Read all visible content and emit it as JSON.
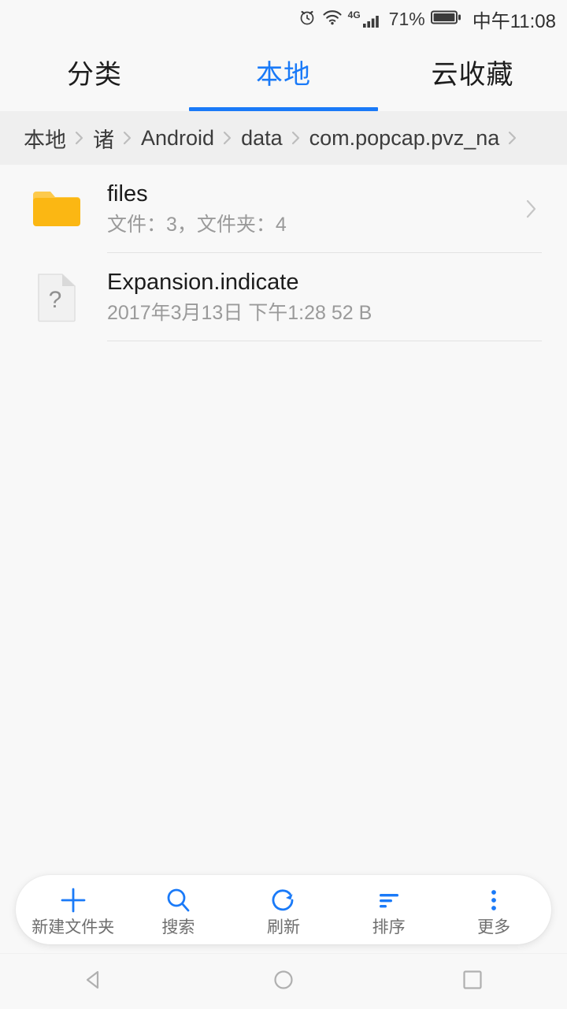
{
  "colors": {
    "accent": "#1a7af8",
    "folder": "#fbb713",
    "folder_tab": "#fdca4c",
    "page_bg": "#f8f8f8",
    "breadcrumb_bg": "#efefef",
    "divider": "#e3e3e3",
    "text_primary": "#1c1c1c",
    "text_secondary": "#9a9a9a",
    "nav_icon": "#b0b0b0"
  },
  "status_bar": {
    "alarm_icon": "alarm-clock-icon",
    "wifi_icon": "wifi-icon",
    "network_type": "4G",
    "signal_icon": "cellular-signal-icon",
    "battery_percent": "71%",
    "battery_icon": "battery-icon",
    "time": "中午11:08"
  },
  "tabs": [
    {
      "label": "分类",
      "active": false,
      "name": "tab-categories"
    },
    {
      "label": "本地",
      "active": true,
      "name": "tab-local"
    },
    {
      "label": "云收藏",
      "active": false,
      "name": "tab-cloud-favorites"
    }
  ],
  "breadcrumb": {
    "items": [
      "本地",
      "诸",
      "Android",
      "data",
      "com.popcap.pvz_na"
    ],
    "separator_icon": "chevron-right-icon",
    "truncated": true
  },
  "file_list": [
    {
      "name": "files",
      "meta": "文件：3，文件夹：4",
      "icon": "folder-icon",
      "type": "folder",
      "has_chevron": true
    },
    {
      "name": "Expansion.indicate",
      "meta": "2017年3月13日 下午1:28 52 B",
      "icon": "unknown-file-icon",
      "type": "file",
      "has_chevron": false
    }
  ],
  "toolbar": [
    {
      "label": "新建文件夹",
      "icon": "plus-icon",
      "name": "new-folder-button"
    },
    {
      "label": "搜索",
      "icon": "search-icon",
      "name": "search-button"
    },
    {
      "label": "刷新",
      "icon": "refresh-icon",
      "name": "refresh-button"
    },
    {
      "label": "排序",
      "icon": "sort-icon",
      "name": "sort-button"
    },
    {
      "label": "更多",
      "icon": "more-vertical-icon",
      "name": "more-button"
    }
  ],
  "nav_bar": {
    "back_icon": "back-triangle-icon",
    "home_icon": "home-circle-icon",
    "recents_icon": "recents-square-icon"
  }
}
